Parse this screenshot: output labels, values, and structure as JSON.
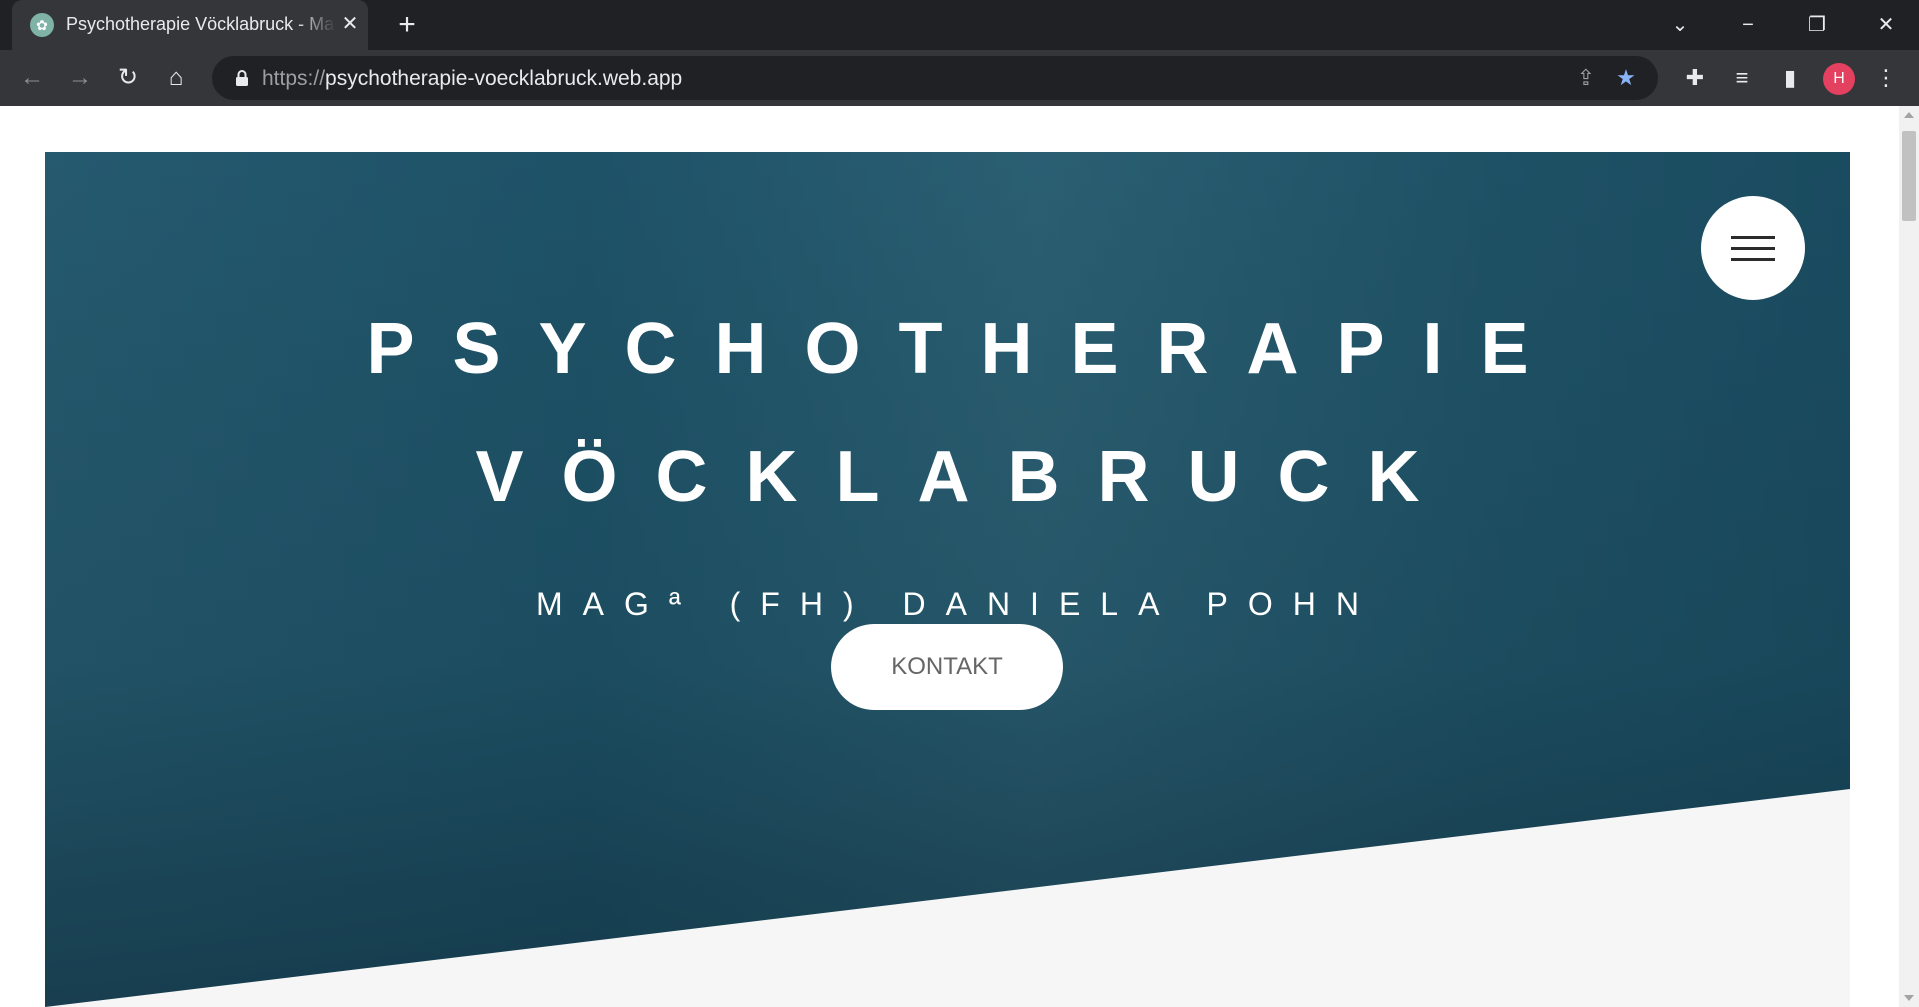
{
  "browser": {
    "tab_title": "Psychotherapie Vöcklabruck - Magª (FH) Daniela Pohn",
    "url_scheme": "https://",
    "url_host": "psychotherapie-voecklabruck.web.app",
    "profile_initial": "H"
  },
  "icons": {
    "favicon": "head-leaf-icon",
    "close_tab": "close-icon",
    "new_tab": "plus-icon",
    "tab_search": "chevron-down-icon",
    "minimize": "minimize-icon",
    "restore": "restore-icon",
    "close_window": "close-icon",
    "back": "arrow-left-icon",
    "forward": "arrow-right-icon",
    "reload": "reload-icon",
    "home": "home-icon",
    "lock": "lock-icon",
    "share": "share-icon",
    "bookmark": "star-icon",
    "extensions": "puzzle-icon",
    "media": "media-queue-icon",
    "side_panel": "side-panel-icon",
    "more": "kebab-icon",
    "menu": "hamburger-icon"
  },
  "colors": {
    "bookmark_star": "#8ab4f8",
    "profile": "#e4405f",
    "hero_overlay": "#12485e",
    "lower_section": "#f6f6f6"
  },
  "hero": {
    "title_line1": "PSYCHOTHERAPIE",
    "title_line2": "VÖCKLABRUCK",
    "subtitle": "MAGª (FH) DANIELA POHN",
    "cta_label": "KONTAKT"
  }
}
